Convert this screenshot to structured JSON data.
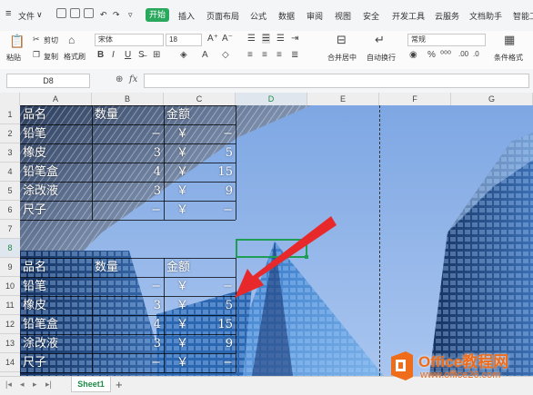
{
  "menubar": {
    "file_label": "文件",
    "tabs": [
      "开始",
      "插入",
      "页面布局",
      "公式",
      "数据",
      "审阅",
      "视图",
      "安全",
      "开发工具",
      "云服务",
      "文档助手",
      "智能工"
    ]
  },
  "ribbon": {
    "paste": "粘贴",
    "cut": "剪切",
    "copy": "复制",
    "format_painter": "格式刷",
    "font_name": "宋体",
    "font_size": "18",
    "merge_center": "合并居中",
    "wrap_text": "自动换行",
    "number_format": "常规",
    "conditional_format": "条件格式"
  },
  "formula_bar": {
    "name_box": "D8",
    "fx": "fx",
    "formula": ""
  },
  "grid": {
    "columns": [
      "A",
      "B",
      "C",
      "D",
      "E",
      "F",
      "G"
    ],
    "rows": [
      "1",
      "2",
      "3",
      "4",
      "5",
      "6",
      "7",
      "8",
      "9",
      "10",
      "11",
      "12",
      "13",
      "14"
    ],
    "table1": {
      "headers": [
        "品名",
        "数量",
        "金额"
      ],
      "rows": [
        [
          "铅笔",
          "−",
          "￥",
          "−"
        ],
        [
          "橡皮",
          "3",
          "￥",
          "5"
        ],
        [
          "铅笔盒",
          "4",
          "￥",
          "15"
        ],
        [
          "涂改液",
          "3",
          "￥",
          "9"
        ],
        [
          "尺子",
          "−",
          "￥",
          "−"
        ]
      ]
    },
    "table2": {
      "headers": [
        "品名",
        "数量",
        "金额"
      ],
      "rows": [
        [
          "铅笔",
          "−",
          "￥",
          "−"
        ],
        [
          "橡皮",
          "3",
          "￥",
          "5"
        ],
        [
          "铅笔盒",
          "4",
          "￥",
          "15"
        ],
        [
          "涂改液",
          "3",
          "￥",
          "9"
        ],
        [
          "尺子",
          "−",
          "￥",
          "−"
        ]
      ]
    }
  },
  "sheet_tabs": {
    "active": "Sheet1",
    "add": "+"
  },
  "watermark": {
    "brand": "Office教程网",
    "url": "www.office26.com"
  },
  "colors": {
    "accent_green": "#2aa85e",
    "sky_blue": "#8fb3e8",
    "arrow_red": "#e8292b",
    "watermark_orange": "#ef6c1a"
  }
}
